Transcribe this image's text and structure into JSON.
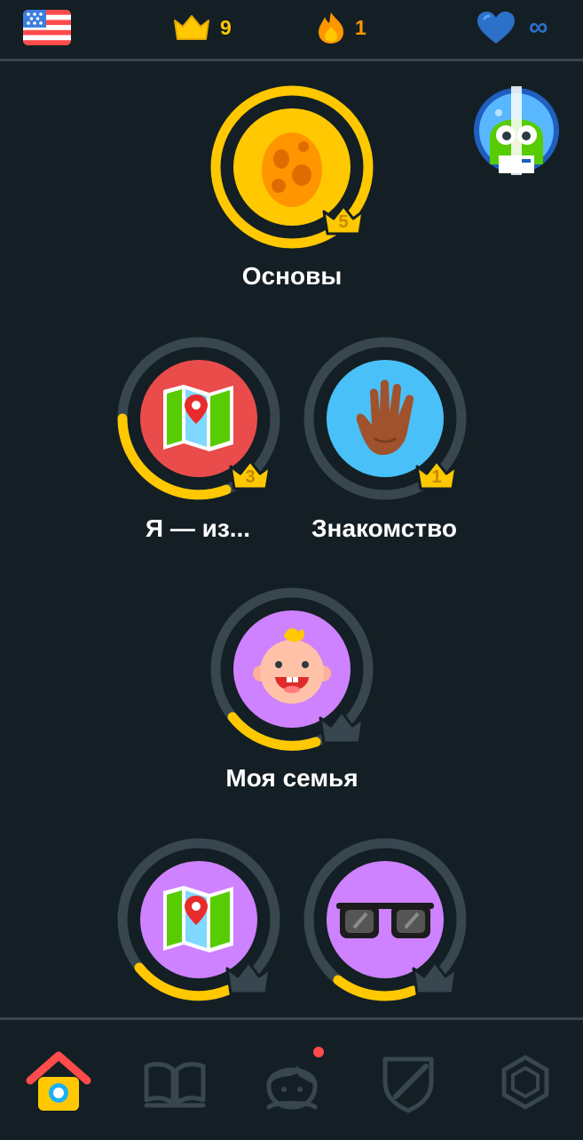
{
  "header": {
    "language_flag": "us-flag-icon",
    "crowns_count": "9",
    "streak_count": "1",
    "hearts_value": "∞"
  },
  "skills": [
    {
      "id": "osnovy",
      "label": "Основы",
      "icon": "egg-icon",
      "crown_level": "5",
      "progress": 1.0,
      "color": "#ffc800"
    },
    {
      "id": "ya-iz",
      "label": "Я — из...",
      "icon": "map-icon",
      "crown_level": "3",
      "progress": 0.35,
      "color": "#ea4b4b"
    },
    {
      "id": "znakomstvo",
      "label": "Знакомство",
      "icon": "hand-wave-icon",
      "crown_level": "1",
      "progress": 0.0,
      "color": "#49c0f8"
    },
    {
      "id": "moya-semya",
      "label": "Моя семья",
      "icon": "baby-icon",
      "crown_level": "",
      "progress": 0.22,
      "color": "#ce82ff"
    },
    {
      "id": "map-2",
      "label": "",
      "icon": "map-icon",
      "crown_level": "",
      "progress": 0.22,
      "color": "#ce82ff"
    },
    {
      "id": "sunglasses",
      "label": "",
      "icon": "sunglasses-icon",
      "crown_level": "",
      "progress": 0.2,
      "color": "#ce82ff"
    }
  ],
  "bottom_nav": [
    {
      "id": "learn",
      "icon": "home-icon",
      "active": true
    },
    {
      "id": "stories",
      "icon": "book-icon",
      "active": false
    },
    {
      "id": "profile",
      "icon": "avatar-icon",
      "active": false,
      "has_notification": true
    },
    {
      "id": "leagues",
      "icon": "shield-icon",
      "active": false
    },
    {
      "id": "shop",
      "icon": "gem-icon",
      "active": false
    }
  ],
  "colors": {
    "background": "#131f24",
    "gold": "#ffc800",
    "ring_track": "#37464f",
    "hearts": "#1cb0f6",
    "streak": "#ff9600"
  }
}
